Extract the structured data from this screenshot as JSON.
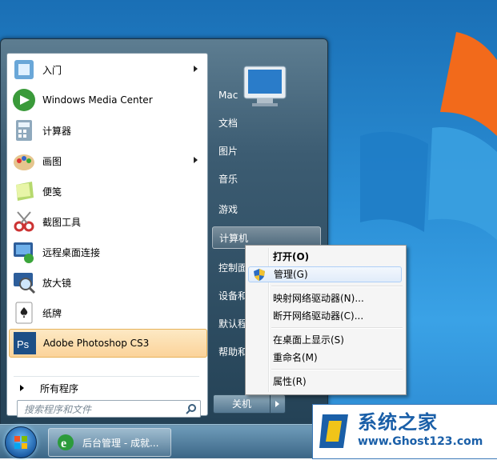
{
  "start_menu": {
    "programs": [
      {
        "label": "入门",
        "icon": "getting-started-icon",
        "has_submenu": true
      },
      {
        "label": "Windows Media Center",
        "icon": "media-center-icon",
        "has_submenu": false
      },
      {
        "label": "计算器",
        "icon": "calculator-icon",
        "has_submenu": false
      },
      {
        "label": "画图",
        "icon": "paint-icon",
        "has_submenu": true
      },
      {
        "label": "便笺",
        "icon": "sticky-notes-icon",
        "has_submenu": false
      },
      {
        "label": "截图工具",
        "icon": "snipping-tool-icon",
        "has_submenu": false
      },
      {
        "label": "远程桌面连接",
        "icon": "remote-desktop-icon",
        "has_submenu": false
      },
      {
        "label": "放大镜",
        "icon": "magnifier-icon",
        "has_submenu": false
      },
      {
        "label": "纸牌",
        "icon": "solitaire-icon",
        "has_submenu": false
      },
      {
        "label": "Adobe Photoshop CS3",
        "icon": "photoshop-icon",
        "has_submenu": true
      }
    ],
    "all_programs": "所有程序",
    "search_placeholder": "搜索程序和文件",
    "right_links": [
      "Mac",
      "文档",
      "图片",
      "音乐",
      "游戏",
      "计算机",
      "控制面",
      "设备和",
      "默认程",
      "帮助和"
    ],
    "shutdown_label": "关机"
  },
  "context_menu": {
    "items": [
      {
        "label": "打开(O)",
        "bold": true
      },
      {
        "label": "管理(G)",
        "icon": "uac-shield-icon"
      },
      {
        "label": "映射网络驱动器(N)..."
      },
      {
        "label": "断开网络驱动器(C)..."
      },
      {
        "label": "在桌面上显示(S)"
      },
      {
        "label": "重命名(M)"
      },
      {
        "label": "属性(R)"
      }
    ]
  },
  "taskbar": {
    "task_label": "后台管理 - 成就..."
  },
  "watermark": {
    "title": "系统之家",
    "url": "www.Ghost123.com"
  },
  "colors": {
    "highlight": "#fbd39a",
    "menu_hover": "#e1ecfa"
  }
}
